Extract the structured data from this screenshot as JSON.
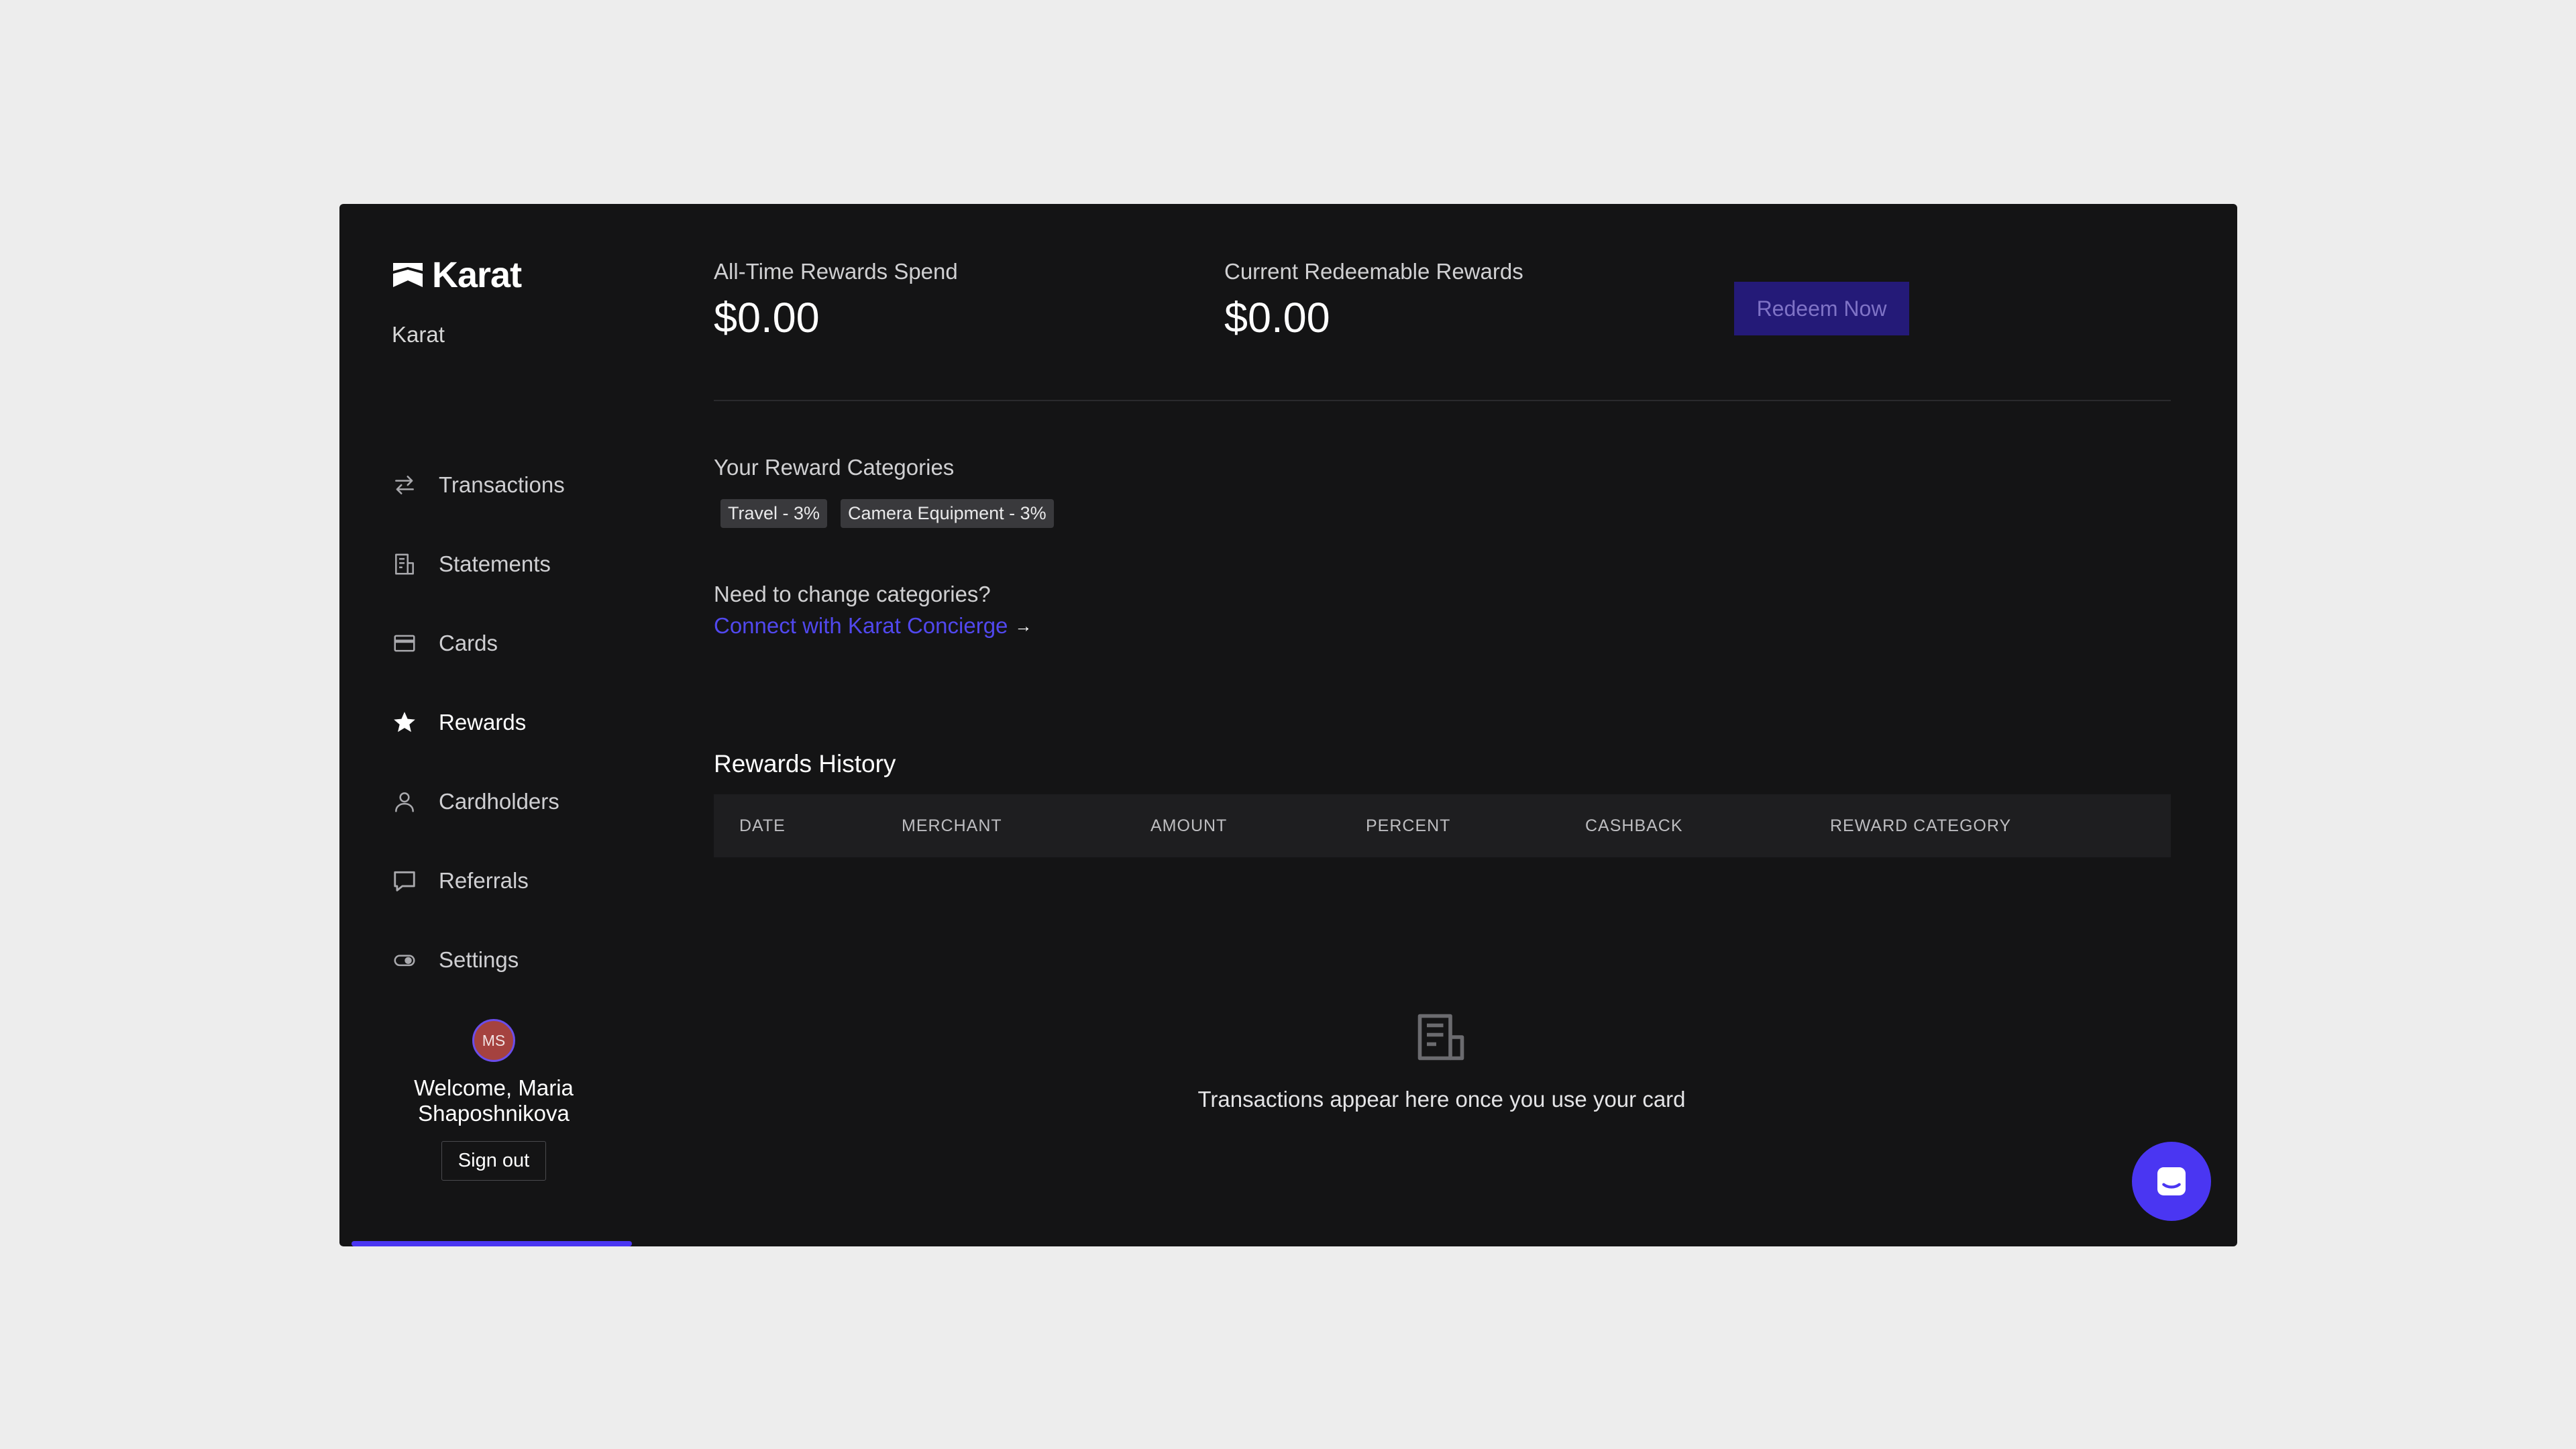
{
  "brand": {
    "logo_text": "Karat",
    "org_name": "Karat"
  },
  "sidebar": {
    "items": [
      {
        "label": "Transactions",
        "icon": "arrows-exchange-icon"
      },
      {
        "label": "Statements",
        "icon": "document-icon"
      },
      {
        "label": "Cards",
        "icon": "credit-card-icon"
      },
      {
        "label": "Rewards",
        "icon": "star-icon",
        "active": true
      },
      {
        "label": "Cardholders",
        "icon": "person-icon"
      },
      {
        "label": "Referrals",
        "icon": "chat-bubble-icon"
      },
      {
        "label": "Settings",
        "icon": "toggle-icon"
      }
    ]
  },
  "user": {
    "initials": "MS",
    "welcome": "Welcome, Maria Shaposhnikova",
    "sign_out": "Sign out"
  },
  "stats": {
    "all_time_label": "All-Time Rewards Spend",
    "all_time_value": "$0.00",
    "redeemable_label": "Current Redeemable Rewards",
    "redeemable_value": "$0.00",
    "redeem_button": "Redeem Now"
  },
  "categories": {
    "title": "Your Reward Categories",
    "chips": [
      "Travel - 3%",
      "Camera Equipment - 3%"
    ],
    "change_question": "Need to change categories?",
    "concierge_link": "Connect with Karat Concierge",
    "arrow": "→"
  },
  "history": {
    "title": "Rewards History",
    "columns": [
      "DATE",
      "MERCHANT",
      "AMOUNT",
      "PERCENT",
      "CASHBACK",
      "REWARD CATEGORY"
    ],
    "empty_text": "Transactions appear here once you use your card"
  },
  "colors": {
    "accent": "#4a36f2",
    "link": "#5148ee",
    "panel": "#141415",
    "redeem_bg": "#241a78"
  }
}
